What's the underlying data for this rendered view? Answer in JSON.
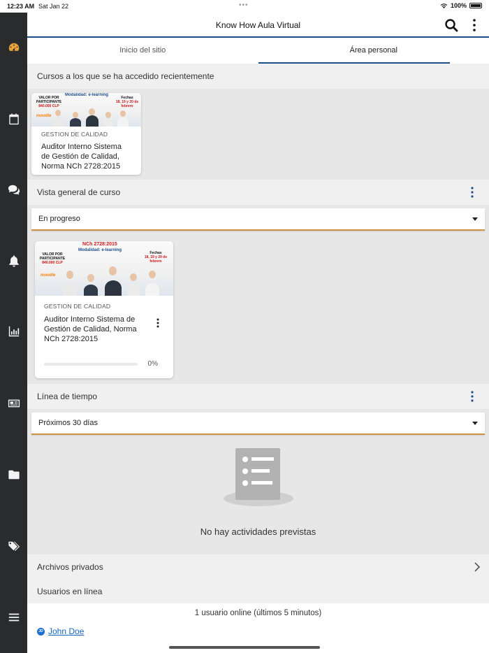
{
  "status_bar": {
    "time": "12:23 AM",
    "date": "Sat Jan 22",
    "dots": "•••",
    "battery": "100%"
  },
  "header": {
    "title": "Know How Aula Virtual"
  },
  "tabs": [
    {
      "label": "Inicio del sitio"
    },
    {
      "label": "Área personal"
    }
  ],
  "recent": {
    "heading": "Cursos a los que se ha accedido recientemente",
    "course": {
      "category": "GESTION DE CALIDAD",
      "name": "Auditor Interno Sistema de Gestión de Calidad, Norma NCh 2728:2015",
      "image": {
        "valor": "VALOR POR PARTICIPANTE",
        "precio": "840.000 CLP",
        "modalidad": "Modalidad: e-learning",
        "fechas_label": "Fechas",
        "fechas": "18, 19 y 20 de febrero",
        "brand": "moodle"
      }
    }
  },
  "overview": {
    "heading": "Vista general de curso",
    "filter": "En progreso",
    "course": {
      "category": "GESTION DE CALIDAD",
      "name": "Auditor Interno Sistema de Gestión de Calidad, Norma NCh 2728:2015",
      "progress_percent": 0,
      "progress_label": "0%",
      "image": {
        "norma": "NCh 2728:2015",
        "valor": "VALOR POR PARTICIPANTE",
        "precio": "840.000 CLP",
        "modalidad": "Modalidad: e-learning",
        "fechas_label": "Fechas",
        "fechas": "18, 19 y 20 de febrero",
        "brand": "moodle"
      }
    }
  },
  "timeline": {
    "heading": "Línea de tiempo",
    "filter": "Próximos 30 días",
    "empty": "No hay actividades previstas"
  },
  "private_files": {
    "label": "Archivos privados"
  },
  "online_users": {
    "heading": "Usuarios en línea",
    "count_text": "1 usuario online (últimos 5 minutos)",
    "users": [
      {
        "initials": "JD",
        "name": "John Doe"
      }
    ]
  },
  "colors": {
    "rail": "#2a2b2c",
    "accent": "#1d4f8b",
    "dropdown_border": "#c9933f",
    "link": "#1565c0"
  },
  "rail_icons": [
    "dashboard-icon",
    "calendar-icon",
    "messages-icon",
    "notifications-icon",
    "grades-icon",
    "news-icon",
    "files-icon",
    "tags-icon",
    "menu-icon"
  ]
}
